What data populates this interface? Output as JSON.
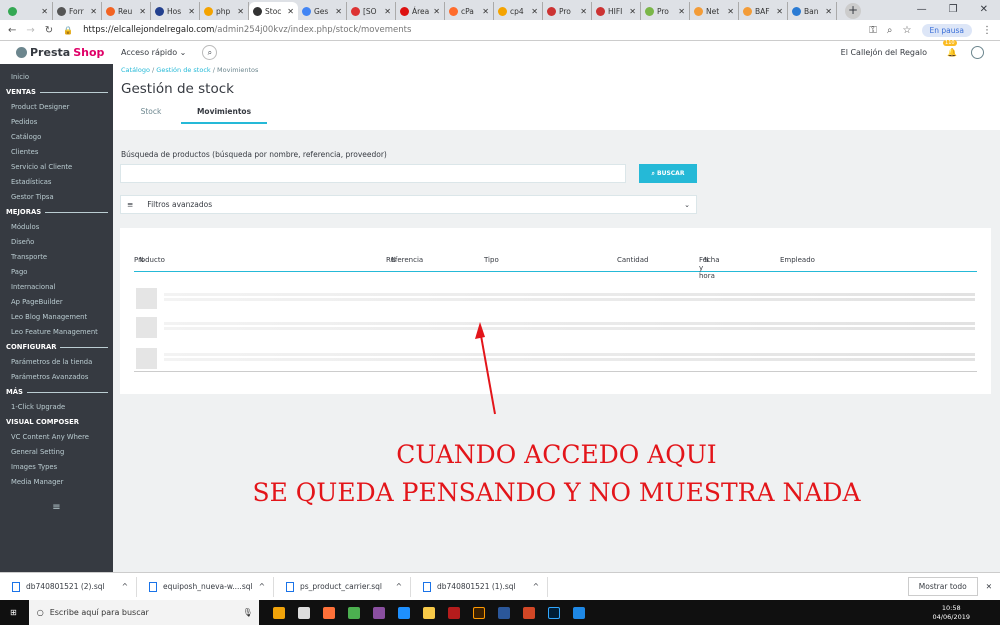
{
  "browser": {
    "tabs": [
      {
        "label": "",
        "color": "#34a853"
      },
      {
        "label": "Forr",
        "color": "#555"
      },
      {
        "label": "Reu",
        "color": "#f26322"
      },
      {
        "label": "Hos",
        "color": "#23408e"
      },
      {
        "label": "php",
        "color": "#f4a300"
      },
      {
        "label": "Stoc",
        "color": "#333",
        "active": true
      },
      {
        "label": "Ges",
        "color": "#4285f4"
      },
      {
        "label": "[SO",
        "color": "#d33"
      },
      {
        "label": "Área",
        "color": "#d11"
      },
      {
        "label": "cPa",
        "color": "#ff6c2c"
      },
      {
        "label": "cp4",
        "color": "#f4a300"
      },
      {
        "label": "Pro",
        "color": "#c33"
      },
      {
        "label": "HIFI",
        "color": "#c33"
      },
      {
        "label": "Pro",
        "color": "#7ab648"
      },
      {
        "label": "Net",
        "color": "#f39c38"
      },
      {
        "label": "BAF",
        "color": "#f39c38"
      },
      {
        "label": "Ban",
        "color": "#2a7bd4"
      }
    ],
    "url_host": "https://elcallejondelregalo.com",
    "url_path": "/admin254j00kvz/index.php/stock/movements",
    "profile": "En pausa"
  },
  "header": {
    "brand_a": "Presta",
    "brand_b": "Shop",
    "quick_access": "Acceso rápido",
    "shop_name": "El Callejón del Regalo",
    "notifications": "110"
  },
  "sidebar": [
    {
      "type": "item",
      "label": "Inicio"
    },
    {
      "type": "head",
      "label": "VENTAS"
    },
    {
      "type": "item",
      "label": "Product Designer"
    },
    {
      "type": "item",
      "label": "Pedidos"
    },
    {
      "type": "item",
      "label": "Catálogo"
    },
    {
      "type": "item",
      "label": "Clientes"
    },
    {
      "type": "item",
      "label": "Servicio al Cliente"
    },
    {
      "type": "item",
      "label": "Estadísticas"
    },
    {
      "type": "item",
      "label": "Gestor Tipsa"
    },
    {
      "type": "head",
      "label": "MEJORAS"
    },
    {
      "type": "item",
      "label": "Módulos"
    },
    {
      "type": "item",
      "label": "Diseño"
    },
    {
      "type": "item",
      "label": "Transporte"
    },
    {
      "type": "item",
      "label": "Pago"
    },
    {
      "type": "item",
      "label": "Internacional"
    },
    {
      "type": "item",
      "label": "Ap PageBuilder"
    },
    {
      "type": "item",
      "label": "Leo Blog Management"
    },
    {
      "type": "item",
      "label": "Leo Feature Management"
    },
    {
      "type": "head",
      "label": "CONFIGURAR"
    },
    {
      "type": "item",
      "label": "Parámetros de la tienda"
    },
    {
      "type": "item",
      "label": "Parámetros Avanzados"
    },
    {
      "type": "head",
      "label": "MÁS"
    },
    {
      "type": "item",
      "label": "1-Click Upgrade"
    },
    {
      "type": "head",
      "label": "VISUAL COMPOSER",
      "noline": true
    },
    {
      "type": "item",
      "label": "VC Content Any Where"
    },
    {
      "type": "item",
      "label": "General Setting"
    },
    {
      "type": "item",
      "label": "Images Types"
    },
    {
      "type": "item",
      "label": "Media Manager"
    }
  ],
  "main": {
    "breadcrumb": [
      "Catálogo",
      "Gestión de stock",
      "Movimientos"
    ],
    "title": "Gestión de stock",
    "tabs": [
      "Stock",
      "Movimientos"
    ],
    "search_label": "Búsqueda de productos (búsqueda por nombre, referencia, proveedor)",
    "search_value": "",
    "search_button": "BUSCAR",
    "filters": "Filtros avanzados",
    "columns": [
      "Producto",
      "Referencia",
      "Tipo",
      "Cantidad",
      "Fecha y hora",
      "Empleado"
    ]
  },
  "annotation": [
    "CUANDO ACCEDO AQUI",
    "SE QUEDA PENSANDO Y NO MUESTRA NADA"
  ],
  "downloads": {
    "files": [
      "db740801521 (2).sql",
      "equiposh_nueva-w....sql",
      "ps_product_carrier.sql",
      "db740801521 (1).sql"
    ],
    "show_all": "Mostrar todo"
  },
  "taskbar": {
    "search": "Escribe aquí para buscar",
    "time": "10:58",
    "date": "04/06/2019"
  }
}
